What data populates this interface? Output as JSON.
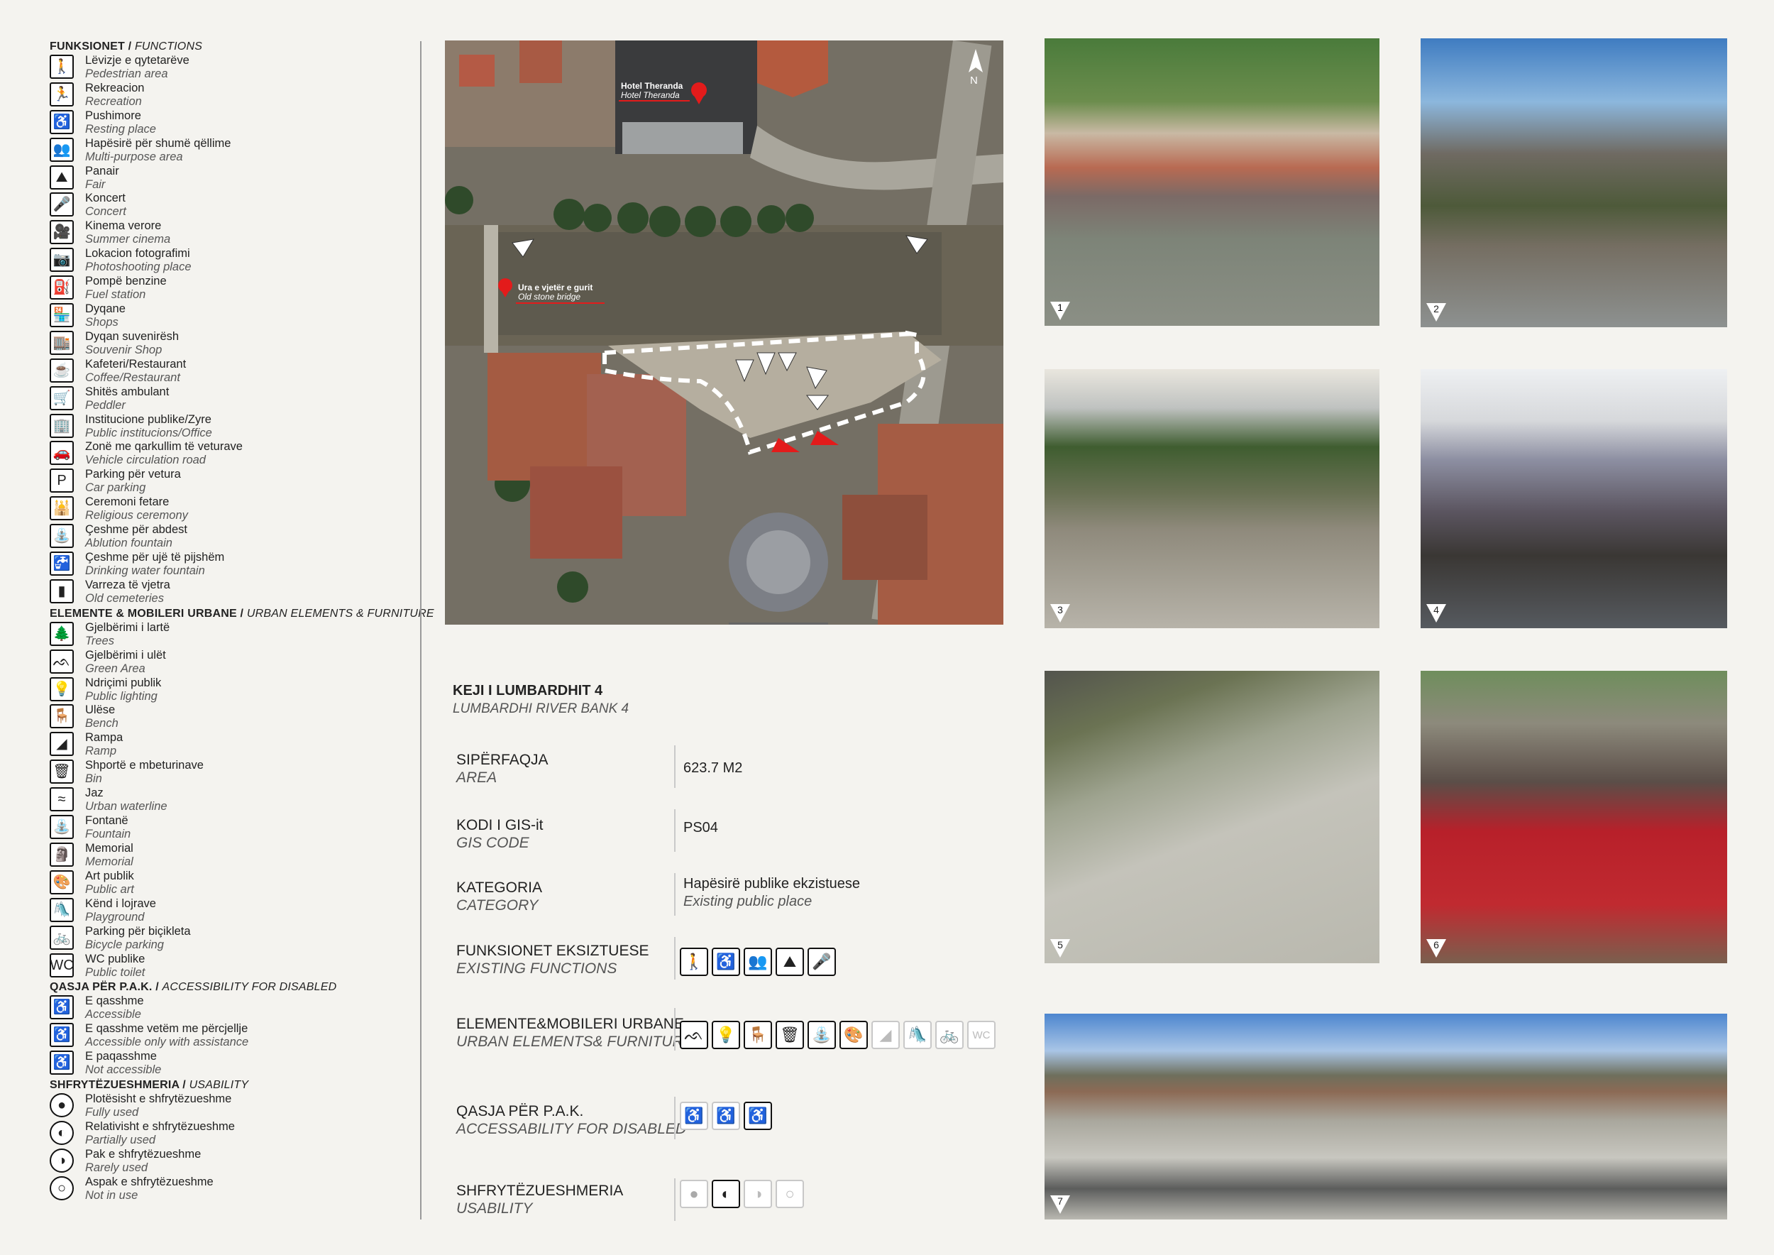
{
  "legend": {
    "functions_header": {
      "al": "FUNKSIONET /",
      "en": "FUNCTIONS"
    },
    "functions": [
      {
        "al": "Lëvizje e qytetarëve",
        "en": "Pedestrian area",
        "icon": "pedestrian-icon",
        "glyph": "🚶"
      },
      {
        "al": "Rekreacion",
        "en": "Recreation",
        "icon": "running-icon",
        "glyph": "🏃"
      },
      {
        "al": "Pushimore",
        "en": "Resting place",
        "icon": "sitting-person-icon",
        "glyph": "♿"
      },
      {
        "al": "Hapësirë për shumë qëllime",
        "en": "Multi-purpose area",
        "icon": "group-people-icon",
        "glyph": "👥"
      },
      {
        "al": "Panair",
        "en": "Fair",
        "icon": "fair-tent-icon",
        "glyph": "⛰"
      },
      {
        "al": "Koncert",
        "en": "Concert",
        "icon": "microphone-icon",
        "glyph": "🎤"
      },
      {
        "al": "Kinema verore",
        "en": "Summer cinema",
        "icon": "film-camera-icon",
        "glyph": "🎥"
      },
      {
        "al": "Lokacion fotografimi",
        "en": "Photoshooting place",
        "icon": "camera-icon",
        "glyph": "📷"
      },
      {
        "al": "Pompë benzine",
        "en": "Fuel station",
        "icon": "fuel-pump-icon",
        "glyph": "⛽"
      },
      {
        "al": "Dyqane",
        "en": "Shops",
        "icon": "shop-icon",
        "glyph": "🏪"
      },
      {
        "al": "Dyqan suvenirësh",
        "en": "Souvenir Shop",
        "icon": "souvenir-shop-icon",
        "glyph": "🏬"
      },
      {
        "al": "Kafeteri/Restaurant",
        "en": "Coffee/Restaurant",
        "icon": "coffee-cup-icon",
        "glyph": "☕"
      },
      {
        "al": "Shitës ambulant",
        "en": "Peddler",
        "icon": "cart-icon",
        "glyph": "🛒"
      },
      {
        "al": "Institucione publike/Zyre",
        "en": "Public institucions/Office",
        "icon": "building-icon",
        "glyph": "🏢"
      },
      {
        "al": "Zonë me qarkullim të veturave",
        "en": "Vehicle circulation road",
        "icon": "car-icon",
        "glyph": "🚗"
      },
      {
        "al": "Parking për vetura",
        "en": "Car parking",
        "icon": "parking-icon",
        "glyph": "P"
      },
      {
        "al": "Ceremoni fetare",
        "en": "Religious ceremony",
        "icon": "mosque-icon",
        "glyph": "🕌"
      },
      {
        "al": "Çeshme për abdest",
        "en": "Ablution fountain",
        "icon": "ablution-fountain-icon",
        "glyph": "⛲"
      },
      {
        "al": "Çeshme për ujë të pijshëm",
        "en": "Drinking water fountain",
        "icon": "drinking-fountain-icon",
        "glyph": "🚰"
      },
      {
        "al": "Varreza të vjetra",
        "en": "Old cemeteries",
        "icon": "tombstone-icon",
        "glyph": "▮"
      }
    ],
    "elements_header": {
      "al": "ELEMENTE & MOBILERI URBANE /",
      "en": "URBAN ELEMENTS & FURNITURE"
    },
    "elements": [
      {
        "al": "Gjelbërimi i lartë",
        "en": "Trees",
        "icon": "tree-icon",
        "glyph": "🌲"
      },
      {
        "al": "Gjelbërimi i ulët",
        "en": "Green Area",
        "icon": "grass-icon",
        "glyph": "ᨒ"
      },
      {
        "al": "Ndriçimi publik",
        "en": "Public lighting",
        "icon": "street-lamp-icon",
        "glyph": "💡"
      },
      {
        "al": "Ulëse",
        "en": "Bench",
        "icon": "bench-icon",
        "glyph": "🪑"
      },
      {
        "al": "Rampa",
        "en": "Ramp",
        "icon": "ramp-icon",
        "glyph": "◢"
      },
      {
        "al": "Shportë e mbeturinave",
        "en": "Bin",
        "icon": "trash-bin-icon",
        "glyph": "🗑"
      },
      {
        "al": "Jaz",
        "en": "Urban waterline",
        "icon": "waterline-icon",
        "glyph": "≈"
      },
      {
        "al": "Fontanë",
        "en": "Fountain",
        "icon": "fountain-icon",
        "glyph": "⛲"
      },
      {
        "al": "Memorial",
        "en": "Memorial",
        "icon": "memorial-icon",
        "glyph": "🗿"
      },
      {
        "al": "Art publik",
        "en": "Public art",
        "icon": "palette-icon",
        "glyph": "🎨"
      },
      {
        "al": "Kënd i lojrave",
        "en": "Playground",
        "icon": "playground-icon",
        "glyph": "🛝"
      },
      {
        "al": "Parking për biçikleta",
        "en": "Bicycle parking",
        "icon": "bicycle-parking-icon",
        "glyph": "🚲"
      },
      {
        "al": "WC publike",
        "en": "Public toilet",
        "icon": "wc-icon",
        "glyph": "WC"
      }
    ],
    "access_header": {
      "al": "QASJA PËR P.A.K. /",
      "en": "ACCESSIBILITY FOR DISABLED"
    },
    "access": [
      {
        "al": "E qasshme",
        "en": "Accessible",
        "icon": "wheelchair-icon",
        "glyph": "♿"
      },
      {
        "al": "E qasshme vetëm me përcjellje",
        "en": "Accessible only with assistance",
        "icon": "wheelchair-assisted-icon",
        "glyph": "♿"
      },
      {
        "al": "E paqasshme",
        "en": "Not accessible",
        "icon": "wheelchair-crossed-icon",
        "glyph": "♿"
      }
    ],
    "usability_header": {
      "al": "SHFRYTËZUESHMERIA /",
      "en": "USABILITY"
    },
    "usability": [
      {
        "al": "Plotësisht e shfrytëzueshme",
        "en": "Fully used",
        "icon": "full-circle-icon",
        "glyph": "●"
      },
      {
        "al": "Relativisht e shfrytëzueshme",
        "en": "Partially used",
        "icon": "half-circle-icon",
        "glyph": "◐"
      },
      {
        "al": "Pak e shfrytëzueshme",
        "en": "Rarely used",
        "icon": "quarter-circle-icon",
        "glyph": "◑"
      },
      {
        "al": "Aspak e shfrytëzueshme",
        "en": "Not in use",
        "icon": "empty-circle-icon",
        "glyph": "○"
      }
    ]
  },
  "map": {
    "compass": "N",
    "hotel_label": "Hotel Theranda",
    "hotel_label_en": "Hotel Theranda",
    "bridge_label": "Ura e vjetër e gurit",
    "bridge_label_en": "Old stone bridge",
    "viewpoints": [
      "1",
      "2",
      "3",
      "4",
      "5",
      "6",
      "7"
    ]
  },
  "info": {
    "title": "KEJI I LUMBARDHIT 4",
    "subtitle": "LUMBARDHI RIVER BANK 4",
    "area_label": "SIPËRFAQJA",
    "area_label_en": "AREA",
    "area_value": "623.7 M2",
    "gis_label": "KODI  I GIS-it",
    "gis_label_en": "GIS CODE",
    "gis_value": "PS04",
    "category_label": "KATEGORIA",
    "category_label_en": "CATEGORY",
    "category_value": "Hapësirë publike ekzistuese",
    "category_value_en": "Existing public place",
    "functions_label": "FUNKSIONET EKSIZTUESE",
    "functions_label_en": "EXISTING FUNCTIONS",
    "elements_label": "ELEMENTE&MOBILERI URBANE",
    "elements_label_en": "URBAN ELEMENTS& FURNITURE",
    "access_label": "QASJA PËR P.A.K.",
    "access_label_en": "ACCESSABILITY FOR DISABLED",
    "usability_label": "SHFRYTËZUESHMERIA",
    "usability_label_en": "USABILITY"
  },
  "photos": [
    {
      "num": "1",
      "desc": "river-festival-photo"
    },
    {
      "num": "2",
      "desc": "mosque-riverbank-photo"
    },
    {
      "num": "3",
      "desc": "steps-railing-photo"
    },
    {
      "num": "4",
      "desc": "fountain-graffiti-photo"
    },
    {
      "num": "5",
      "desc": "bicycle-rack-photo"
    },
    {
      "num": "6",
      "desc": "folk-dance-photo"
    },
    {
      "num": "7",
      "desc": "panorama-photo"
    }
  ],
  "colors": {
    "accent_red": "#e31b1b",
    "ink": "#222222"
  }
}
